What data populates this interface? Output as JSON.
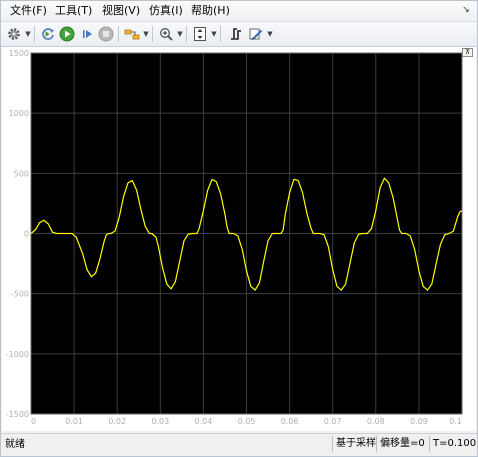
{
  "menubar": {
    "items": [
      "文件(F)",
      "工具(T)",
      "视图(V)",
      "仿真(I)",
      "帮助(H)"
    ],
    "collapse_glyph": "↘"
  },
  "toolbar": {
    "buttons": [
      {
        "name": "gear-icon",
        "has_dropdown": true
      },
      {
        "name": "step-back-icon",
        "has_dropdown": false
      },
      {
        "name": "run-icon",
        "has_dropdown": false
      },
      {
        "name": "step-forward-icon",
        "has_dropdown": false
      },
      {
        "name": "stop-icon",
        "has_dropdown": false
      },
      {
        "name": "highlight-block-icon",
        "has_dropdown": true
      },
      {
        "name": "zoom-in-icon",
        "has_dropdown": true
      },
      {
        "name": "autoscale-icon",
        "has_dropdown": true
      },
      {
        "name": "trigger-icon",
        "has_dropdown": false
      },
      {
        "name": "edit-style-icon",
        "has_dropdown": true
      }
    ]
  },
  "colors": {
    "plot_background": "#000000",
    "grid": "#3d3d3d",
    "trace": "#ffff00",
    "tick_text": "#b0b0b0"
  },
  "expand_glyph": "⊼",
  "chart_data": {
    "type": "line",
    "title": "",
    "xlabel": "",
    "ylabel": "",
    "xlim": [
      0,
      0.1
    ],
    "ylim": [
      -1500,
      1500
    ],
    "xticks": [
      0,
      0.01,
      0.02,
      0.03,
      0.04,
      0.05,
      0.06,
      0.07,
      0.08,
      0.09,
      0.1
    ],
    "xtick_labels": [
      "0",
      "0.01",
      "0.02",
      "0.03",
      "0.04",
      "0.05",
      "0.06",
      "0.07",
      "0.08",
      "0.09",
      "0.1"
    ],
    "yticks": [
      -1500,
      -1000,
      -500,
      0,
      500,
      1000,
      1500
    ],
    "ytick_labels": [
      "-1500",
      "-1000",
      "-500",
      "0",
      "500",
      "1000",
      "1500"
    ],
    "grid": true,
    "series": [
      {
        "color": "#ffff00",
        "x": [
          0,
          0.001,
          0.002,
          0.003,
          0.004,
          0.005,
          0.006,
          0.008,
          0.0095,
          0.0105,
          0.012,
          0.013,
          0.014,
          0.015,
          0.016,
          0.017,
          0.0175,
          0.018,
          0.0185,
          0.0195,
          0.0205,
          0.0215,
          0.0225,
          0.0235,
          0.0245,
          0.0255,
          0.0265,
          0.0275,
          0.028,
          0.029,
          0.0295,
          0.0305,
          0.0315,
          0.0325,
          0.0335,
          0.0345,
          0.0355,
          0.0365,
          0.0375,
          0.038,
          0.0385,
          0.039,
          0.04,
          0.041,
          0.042,
          0.043,
          0.044,
          0.045,
          0.0455,
          0.046,
          0.047,
          0.048,
          0.049,
          0.05,
          0.051,
          0.052,
          0.053,
          0.054,
          0.055,
          0.056,
          0.057,
          0.058,
          0.0585,
          0.059,
          0.06,
          0.061,
          0.062,
          0.063,
          0.064,
          0.065,
          0.0655,
          0.066,
          0.067,
          0.068,
          0.069,
          0.07,
          0.071,
          0.072,
          0.073,
          0.074,
          0.075,
          0.076,
          0.077,
          0.078,
          0.079,
          0.08,
          0.081,
          0.082,
          0.083,
          0.084,
          0.085,
          0.0855,
          0.086,
          0.087,
          0.088,
          0.089,
          0.09,
          0.091,
          0.092,
          0.093,
          0.094,
          0.095,
          0.096,
          0.097,
          0.098,
          0.099,
          0.0995,
          0.1
        ],
        "y": [
          0,
          30,
          90,
          110,
          80,
          10,
          0,
          0,
          0,
          -30,
          -170,
          -300,
          -360,
          -330,
          -210,
          -60,
          -10,
          0,
          0,
          20,
          140,
          310,
          420,
          440,
          360,
          200,
          60,
          0,
          0,
          -30,
          -100,
          -280,
          -420,
          -460,
          -400,
          -230,
          -60,
          -5,
          0,
          0,
          0,
          40,
          190,
          360,
          450,
          430,
          330,
          160,
          50,
          0,
          0,
          -20,
          -130,
          -310,
          -440,
          -470,
          -410,
          -230,
          -60,
          0,
          0,
          0,
          30,
          160,
          340,
          450,
          440,
          340,
          170,
          40,
          0,
          0,
          0,
          -10,
          -110,
          -300,
          -440,
          -470,
          -420,
          -250,
          -80,
          -5,
          0,
          0,
          40,
          190,
          380,
          460,
          420,
          300,
          120,
          30,
          0,
          0,
          -20,
          -130,
          -310,
          -440,
          -470,
          -420,
          -250,
          -90,
          -10,
          0,
          20,
          140,
          180,
          190
        ]
      }
    ]
  },
  "statusbar": {
    "left": "就绪",
    "sample_mode": "基于采样",
    "offset": "偏移量=0",
    "time": "T=0.100"
  }
}
